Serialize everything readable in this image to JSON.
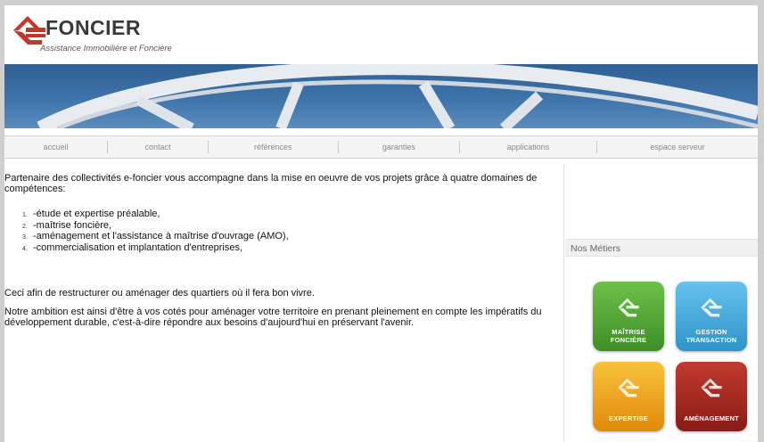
{
  "header": {
    "logo_title": "FONCIER",
    "logo_subtitle": "Assistance Immobilière et Foncière"
  },
  "nav": {
    "items": [
      {
        "label": "accueil"
      },
      {
        "label": "contact"
      },
      {
        "label": "références"
      },
      {
        "label": "garanties"
      },
      {
        "label": "applications"
      },
      {
        "label": "espace serveur"
      }
    ]
  },
  "main": {
    "intro": "Partenaire des collectivités e-foncier vous accompagne dans la mise en oeuvre de vos projets grâce à quatre domaines de compétences:",
    "list": [
      {
        "num": "1.",
        "text": "-étude et expertise préalable,"
      },
      {
        "num": "2.",
        "text": "-maîtrise foncière,"
      },
      {
        "num": "3.",
        "text": "-aménagement et l'assistance à maîtrise d'ouvrage (AMO),"
      },
      {
        "num": "4.",
        "text": "-commercialisation et implantation d'entreprises,"
      }
    ],
    "paragraph1": "Ceci afin de restructurer ou aménager des quartiers où il fera bon vivre.",
    "paragraph2": "Notre ambition est ainsi d'être à vos cotés pour aménager votre territoire en prenant pleinement en compte les impératifs du développement durable, c'est-à-dire répondre aux besoins d'aujourd'hui en préservant l'avenir."
  },
  "sidebar": {
    "title": "Nos Métiers",
    "tiles": [
      {
        "line1": "MAÎTRISE",
        "line2": "FONCIÈRE",
        "color": "#4ea532",
        "icon": "e-foncier-icon"
      },
      {
        "line1": "GESTION",
        "line2": "TRANSACTION",
        "color": "#3fa9dd",
        "icon": "e-foncier-icon"
      },
      {
        "line1": "EXPERTISE",
        "line2": "",
        "color": "#f2a516",
        "icon": "e-foncier-icon"
      },
      {
        "line1": "AMÉNAGEMENT",
        "line2": "",
        "color": "#a62820",
        "icon": "e-foncier-icon"
      }
    ]
  },
  "colors": {
    "brand_red": "#c0392b",
    "banner_blue": "#3e74aa"
  }
}
